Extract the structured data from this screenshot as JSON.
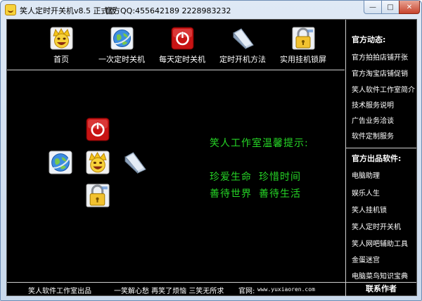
{
  "window": {
    "title": "笑人定时开关机v8.5 正式版",
    "qq": "官方QQ:455642189 2228983232",
    "minimize_label": "—",
    "maximize_label": "□",
    "close_label": "✕"
  },
  "toolbar": {
    "items": [
      {
        "label": "首页",
        "icon": "smiley-face-icon"
      },
      {
        "label": "一次定时关机",
        "icon": "globe-icon"
      },
      {
        "label": "每天定时关机",
        "icon": "power-icon"
      },
      {
        "label": "定时开机方法",
        "icon": "folder-icon"
      },
      {
        "label": "实用挂机锁屏",
        "icon": "lock-icon"
      }
    ]
  },
  "tips": {
    "title": "笑人工作室温馨提示:",
    "line1a": "珍爱生命",
    "line1b": "珍惜时间",
    "line2a": "善待世界",
    "line2b": "善待生活"
  },
  "sidebar": {
    "news_title": "官方动态:",
    "news": [
      "官方拍拍店铺开张",
      "官方淘宝店铺促销",
      "笑人软件工作室简介",
      "技术服务说明",
      "广告业务洽谈",
      "软件定制服务"
    ],
    "products_title": "官方出品软件:",
    "products": [
      "电脑助理",
      "娱乐人生",
      "笑人挂机锁",
      "笑人定时开关机",
      "笑人网吧辅助工具",
      "金蛋迷宫",
      "电脑菜鸟知识宝典"
    ]
  },
  "footer": {
    "studio": "笑人软件工作室出品",
    "slogan": "一笑解心愁 再笑了烦恼 三笑无所求",
    "site_label": "官网:",
    "site_url": "www.yuxiaoren.com",
    "contact": "联系作者"
  },
  "colors": {
    "background": "#000000",
    "tip_green": "#26d626",
    "divider": "#cfcfcf"
  }
}
